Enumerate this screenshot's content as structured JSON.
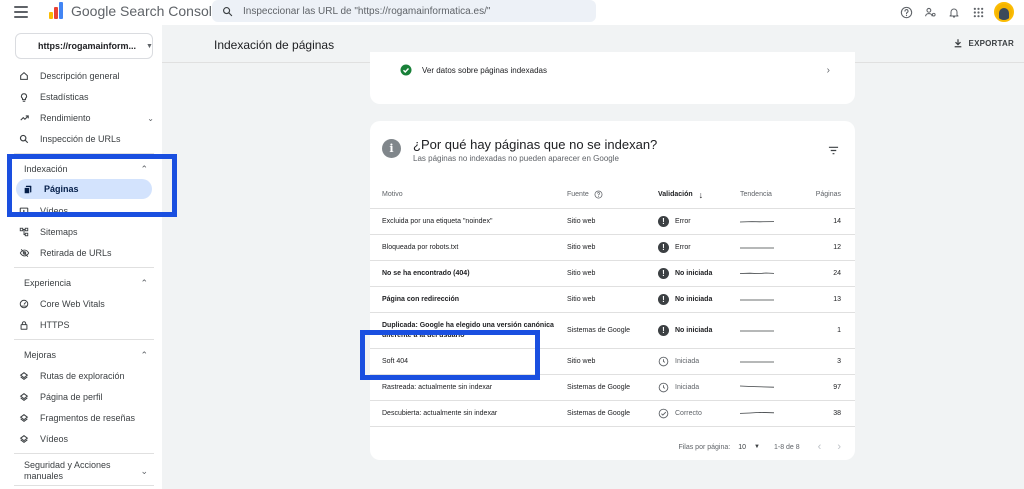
{
  "header": {
    "app_name": "Google Search Console",
    "search_placeholder": "Inspeccionar las URL de \"https://rogamainformatica.es/\""
  },
  "property": {
    "name": "https://rogamainform..."
  },
  "sidebar": {
    "top_items": [
      {
        "label": "Descripción general",
        "icon": "home-icon"
      },
      {
        "label": "Estadísticas",
        "icon": "bulb-icon"
      },
      {
        "label": "Rendimiento",
        "icon": "trending-icon"
      },
      {
        "label": "Inspección de URLs",
        "icon": "search-icon"
      }
    ],
    "sections": [
      {
        "title": "Indexación",
        "items": [
          {
            "label": "Páginas",
            "icon": "pages-icon",
            "active": true
          },
          {
            "label": "Vídeos",
            "icon": "video-icon"
          },
          {
            "label": "Sitemaps",
            "icon": "sitemap-icon"
          },
          {
            "label": "Retirada de URLs",
            "icon": "eye-off-icon"
          }
        ]
      },
      {
        "title": "Experiencia",
        "items": [
          {
            "label": "Core Web Vitals",
            "icon": "gauge-icon"
          },
          {
            "label": "HTTPS",
            "icon": "lock-icon"
          }
        ]
      },
      {
        "title": "Mejoras",
        "items": [
          {
            "label": "Rutas de exploración",
            "icon": "layers-icon"
          },
          {
            "label": "Página de perfil",
            "icon": "layers-icon"
          },
          {
            "label": "Fragmentos de reseñas",
            "icon": "layers-icon"
          },
          {
            "label": "Vídeos",
            "icon": "layers-icon"
          }
        ]
      },
      {
        "title": "Seguridad y Acciones manuales",
        "items": []
      }
    ]
  },
  "main": {
    "title": "Indexación de páginas",
    "export_label": "EXPORTAR",
    "indexed_link": "Ver datos sobre páginas indexadas",
    "card_title": "¿Por qué hay páginas que no se indexan?",
    "card_subtitle": "Las páginas no indexadas no pueden aparecer en Google",
    "table": {
      "headers": {
        "reason": "Motivo",
        "source": "Fuente",
        "validation": "Validación",
        "trend": "Tendencia",
        "pages": "Páginas"
      },
      "rows": [
        {
          "reason": "Excluida por una etiqueta \"noindex\"",
          "source": "Sitio web",
          "validation": "Error",
          "pages": "14"
        },
        {
          "reason": "Bloqueada por robots.txt",
          "source": "Sitio web",
          "validation": "Error",
          "pages": "12"
        },
        {
          "reason": "No se ha encontrado (404)",
          "source": "Sitio web",
          "validation": "No iniciada",
          "pages": "24"
        },
        {
          "reason": "Página con redirección",
          "source": "Sitio web",
          "validation": "No iniciada",
          "pages": "13"
        },
        {
          "reason": "Duplicada: Google ha elegido una versión canónica diferente a la del usuario",
          "source": "Sistemas de Google",
          "validation": "No iniciada",
          "pages": "1"
        },
        {
          "reason": "Soft 404",
          "source": "Sitio web",
          "validation": "Iniciada",
          "pages": "3"
        },
        {
          "reason": "Rastreada: actualmente sin indexar",
          "source": "Sistemas de Google",
          "validation": "Iniciada",
          "pages": "97"
        },
        {
          "reason": "Descubierta: actualmente sin indexar",
          "source": "Sistemas de Google",
          "validation": "Correcto",
          "pages": "38"
        }
      ]
    },
    "pagination": {
      "rows_label": "Filas por página:",
      "rows_value": "10",
      "range": "1-8 de 8"
    }
  },
  "colors": {
    "accent": "#1a4fe0",
    "active_nav": "#d3e3fd",
    "success": "#188038"
  }
}
